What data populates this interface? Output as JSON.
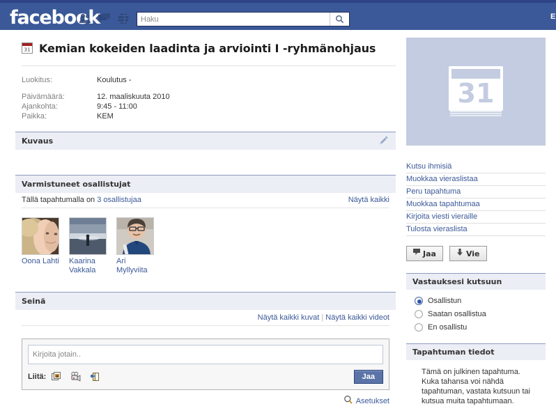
{
  "topbar": {
    "logo": "facebook",
    "icons": [
      "friends-icon",
      "messages-icon",
      "globe-icon"
    ],
    "search": {
      "placeholder": "Haku",
      "value": ""
    },
    "search_button_icon": "search-icon",
    "right_nav_clipped": "E",
    "bg_color": "#3b5998"
  },
  "event": {
    "title": "Kemian kokeiden laadinta ja arviointi I -ryhmänohjaus",
    "title_icon": "calendar-31-icon",
    "info": [
      {
        "label": "Luokitus:",
        "value": "Koulutus -"
      },
      {
        "label": "Päivämäärä:",
        "value": "12. maaliskuuta 2010"
      },
      {
        "label": "Ajankohta:",
        "value": "9:45 - 11:00"
      },
      {
        "label": "Paikka:",
        "value": "KEM"
      }
    ]
  },
  "description": {
    "heading": "Kuvaus",
    "edit_icon": "pencil-icon",
    "body": ""
  },
  "attendees": {
    "heading": "Varmistuneet osallistujat",
    "count_prefix": "Tällä tapahtumalla on ",
    "count_link": "3 osallistujaa",
    "show_all": "Näytä kaikki",
    "people": [
      {
        "name": "Oona Lahti"
      },
      {
        "name": "Kaarina Vakkala"
      },
      {
        "name": "Ari Myllyviita"
      }
    ]
  },
  "wall": {
    "heading": "Seinä",
    "show_all_photos": "Näytä kaikki kuvat",
    "separator": "|",
    "show_all_videos": "Näytä kaikki videot",
    "composer": {
      "placeholder": "Kirjoita jotain..",
      "value": "",
      "attach_label": "Liitä:",
      "attach_icons": [
        "photo-icon",
        "video-icon",
        "link-icon"
      ],
      "share_button": "Jaa"
    },
    "settings_link": "Asetukset",
    "settings_icon": "magnifier-icon"
  },
  "sidebar": {
    "calendar_placeholder": {
      "icon": "calendar-31-large-icon",
      "day": "31",
      "bg": "#c3cce0"
    },
    "links": [
      "Kutsu ihmisiä",
      "Muokkaa vieraslistaa",
      "Peru tapahtuma",
      "Muokkaa tapahtumaa",
      "Kirjoita viesti vieraille",
      "Tulosta vieraslista"
    ],
    "buttons": [
      {
        "label": "Jaa",
        "icon": "share-flag-icon"
      },
      {
        "label": "Vie",
        "icon": "download-arrow-icon"
      }
    ],
    "rsvp": {
      "heading": "Vastauksesi kutsuun",
      "options": [
        {
          "label": "Osallistun",
          "selected": true
        },
        {
          "label": "Saatan osallistua",
          "selected": false
        },
        {
          "label": "En osallistu",
          "selected": false
        }
      ]
    },
    "details": {
      "heading": "Tapahtuman tiedot",
      "text": "Tämä on julkinen tapahtuma. Kuka tahansa voi nähdä tapahtuman, vastata kutsuun tai kutsua muita tapahtumaan."
    }
  }
}
